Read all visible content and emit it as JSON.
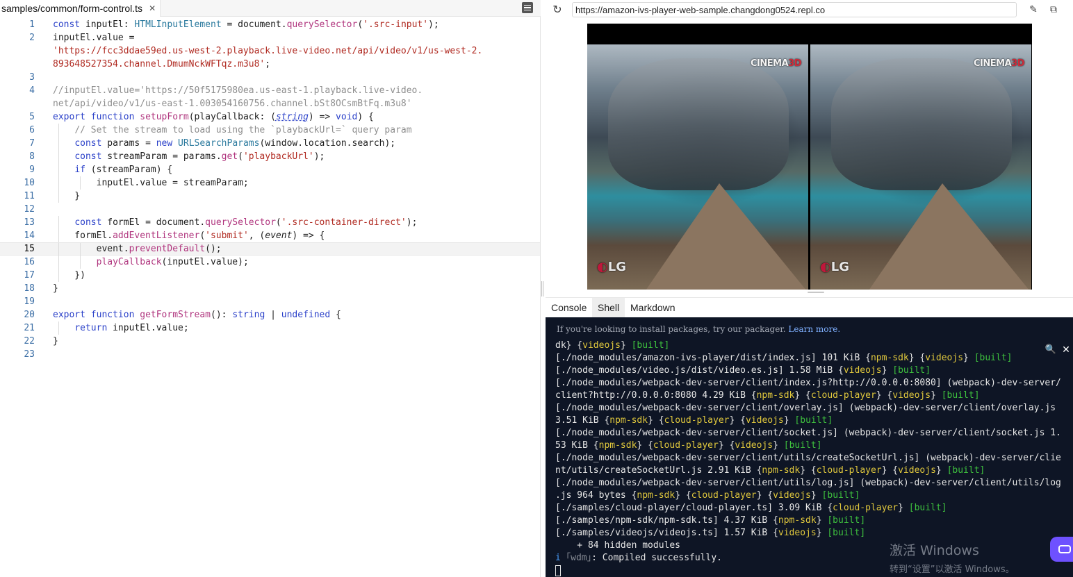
{
  "editor": {
    "file_tab": "samples/common/form-control.ts",
    "close_glyph": "✕",
    "lines": [
      {
        "n": "1",
        "html": "<span class=\"kw\">const</span> inputEl: <span class=\"ty\">HTMLInputElement</span> = document.<span class=\"fn\">querySelector</span>(<span class=\"str\">'.src-input'</span>);"
      },
      {
        "n": "2",
        "html": "inputEl.value ="
      },
      {
        "n": "",
        "html": "<span class=\"str\">'https://fcc3ddae59ed.us-west-2.playback.live-video.net/api/video/v1/us-west-2.</span>"
      },
      {
        "n": "",
        "html": "<span class=\"str\">893648527354.channel.DmumNckWFTqz.m3u8'</span>;"
      },
      {
        "n": "3",
        "html": ""
      },
      {
        "n": "4",
        "html": "<span class=\"cm\">//inputEl.value='https://50f5175980ea.us-east-1.playback.live-video.</span>"
      },
      {
        "n": "",
        "html": "<span class=\"cm\">net/api/video/v1/us-east-1.003054160756.channel.bSt8OCsmBtFq.m3u8'</span>"
      },
      {
        "n": "5",
        "html": "<span class=\"kw\">export</span> <span class=\"kw\">function</span> <span class=\"fn\">setupForm</span>(playCallback: (<span class=\"kw it sq\">string</span>) =&gt; <span class=\"kw\">void</span>) {"
      },
      {
        "n": "6",
        "html": "    <span class=\"cm\">// Set the stream to load using the `playbackUrl=` query param</span>"
      },
      {
        "n": "7",
        "html": "    <span class=\"kw\">const</span> params = <span class=\"kw\">new</span> <span class=\"ty\">URLSearchParams</span>(window.location.search);"
      },
      {
        "n": "8",
        "html": "    <span class=\"kw\">const</span> streamParam = params.<span class=\"fn\">get</span>(<span class=\"str\">'playbackUrl'</span>);"
      },
      {
        "n": "9",
        "html": "    <span class=\"kw\">if</span> (streamParam) {"
      },
      {
        "n": "10",
        "html": "        inputEl.value = streamParam;"
      },
      {
        "n": "11",
        "html": "    }"
      },
      {
        "n": "12",
        "html": ""
      },
      {
        "n": "13",
        "html": "    <span class=\"kw\">const</span> formEl = document.<span class=\"fn\">querySelector</span>(<span class=\"str\">'.src-container-direct'</span>);"
      },
      {
        "n": "14",
        "html": "    formEl.<span class=\"fn\">addEventListener</span>(<span class=\"str\">'submit'</span>, (<span class=\"it\">event</span>) =&gt; {"
      },
      {
        "n": "15",
        "html": "        event.<span class=\"fn\">preventDefault</span>();"
      },
      {
        "n": "16",
        "html": "        <span class=\"fn\">playCallback</span>(inputEl.value);"
      },
      {
        "n": "17",
        "html": "    })"
      },
      {
        "n": "18",
        "html": "}"
      },
      {
        "n": "19",
        "html": ""
      },
      {
        "n": "20",
        "html": "<span class=\"kw\">export</span> <span class=\"kw\">function</span> <span class=\"fn\">getFormStream</span>(): <span class=\"kw\">string</span> | <span class=\"kw\">undefined</span> {"
      },
      {
        "n": "21",
        "html": "    <span class=\"kw\">return</span> inputEl.value;"
      },
      {
        "n": "22",
        "html": "}"
      },
      {
        "n": "23",
        "html": ""
      }
    ],
    "active_line": "15"
  },
  "browser": {
    "url": "https://amazon-ivs-player-web-sample.changdong0524.repl.co",
    "reload_glyph": "↻",
    "edit_glyph": "✎",
    "newtab_glyph": "⧉"
  },
  "video": {
    "cinema_logo": "CINEMA",
    "cinema_logo_accent": "3D",
    "lg_logo_accent": "◐",
    "lg_logo": "LG"
  },
  "tools": {
    "tabs": [
      {
        "label": "Console",
        "active": false
      },
      {
        "label": "Shell",
        "active": true
      },
      {
        "label": "Markdown",
        "active": false
      }
    ]
  },
  "terminal": {
    "hint_text": "If you're looking to install packages, try our packager.",
    "hint_link": "Learn more.",
    "search_glyph": "🔍",
    "close_glyph": "✕",
    "lines": [
      "dk} {<span class=\"y\">videojs</span>} <span class=\"g\">[built]</span>",
      "[./node_modules/amazon-ivs-player/dist/index.js] 101 KiB {<span class=\"y\">npm-sdk</span>} {<span class=\"y\">videojs</span>} <span class=\"g\">[built]</span>",
      "[./node_modules/video.js/dist/video.es.js] 1.58 MiB {<span class=\"y\">videojs</span>} <span class=\"g\">[built]</span>",
      "[./node_modules/webpack-dev-server/client/index.js?http://0.0.0.0:8080] (webpack)-dev-server/",
      "client?http://0.0.0.0:8080 4.29 KiB {<span class=\"y\">npm-sdk</span>} {<span class=\"y\">cloud-player</span>} {<span class=\"y\">videojs</span>} <span class=\"g\">[built]</span>",
      "[./node_modules/webpack-dev-server/client/overlay.js] (webpack)-dev-server/client/overlay.js",
      "3.51 KiB {<span class=\"y\">npm-sdk</span>} {<span class=\"y\">cloud-player</span>} {<span class=\"y\">videojs</span>} <span class=\"g\">[built]</span>",
      "[./node_modules/webpack-dev-server/client/socket.js] (webpack)-dev-server/client/socket.js 1.",
      "53 KiB {<span class=\"y\">npm-sdk</span>} {<span class=\"y\">cloud-player</span>} {<span class=\"y\">videojs</span>} <span class=\"g\">[built]</span>",
      "[./node_modules/webpack-dev-server/client/utils/createSocketUrl.js] (webpack)-dev-server/clie",
      "nt/utils/createSocketUrl.js 2.91 KiB {<span class=\"y\">npm-sdk</span>} {<span class=\"y\">cloud-player</span>} {<span class=\"y\">videojs</span>} <span class=\"g\">[built]</span>",
      "[./node_modules/webpack-dev-server/client/utils/log.js] (webpack)-dev-server/client/utils/log",
      ".js 964 bytes {<span class=\"y\">npm-sdk</span>} {<span class=\"y\">cloud-player</span>} {<span class=\"y\">videojs</span>} <span class=\"g\">[built]</span>",
      "[./samples/cloud-player/cloud-player.ts] 3.09 KiB {<span class=\"y\">cloud-player</span>} <span class=\"g\">[built]</span>",
      "[./samples/npm-sdk/npm-sdk.ts] 4.37 KiB {<span class=\"y\">npm-sdk</span>} <span class=\"g\">[built]</span>",
      "[./samples/videojs/videojs.ts] 1.57 KiB {<span class=\"y\">videojs</span>} <span class=\"g\">[built]</span>",
      "    + 84 hidden modules",
      "<span class=\"b\">i</span> <span class=\"gr\">｢wdm｣</span>: Compiled successfully."
    ],
    "watermark_title": "激活 Windows",
    "watermark_sub": "转到“设置”以激活 Windows。"
  },
  "colors": {
    "terminal_bg": "#0e1525",
    "keyword": "#2b41c9",
    "string": "#b02a21",
    "function": "#b0357e",
    "accent_chat": "#6e51ff"
  }
}
